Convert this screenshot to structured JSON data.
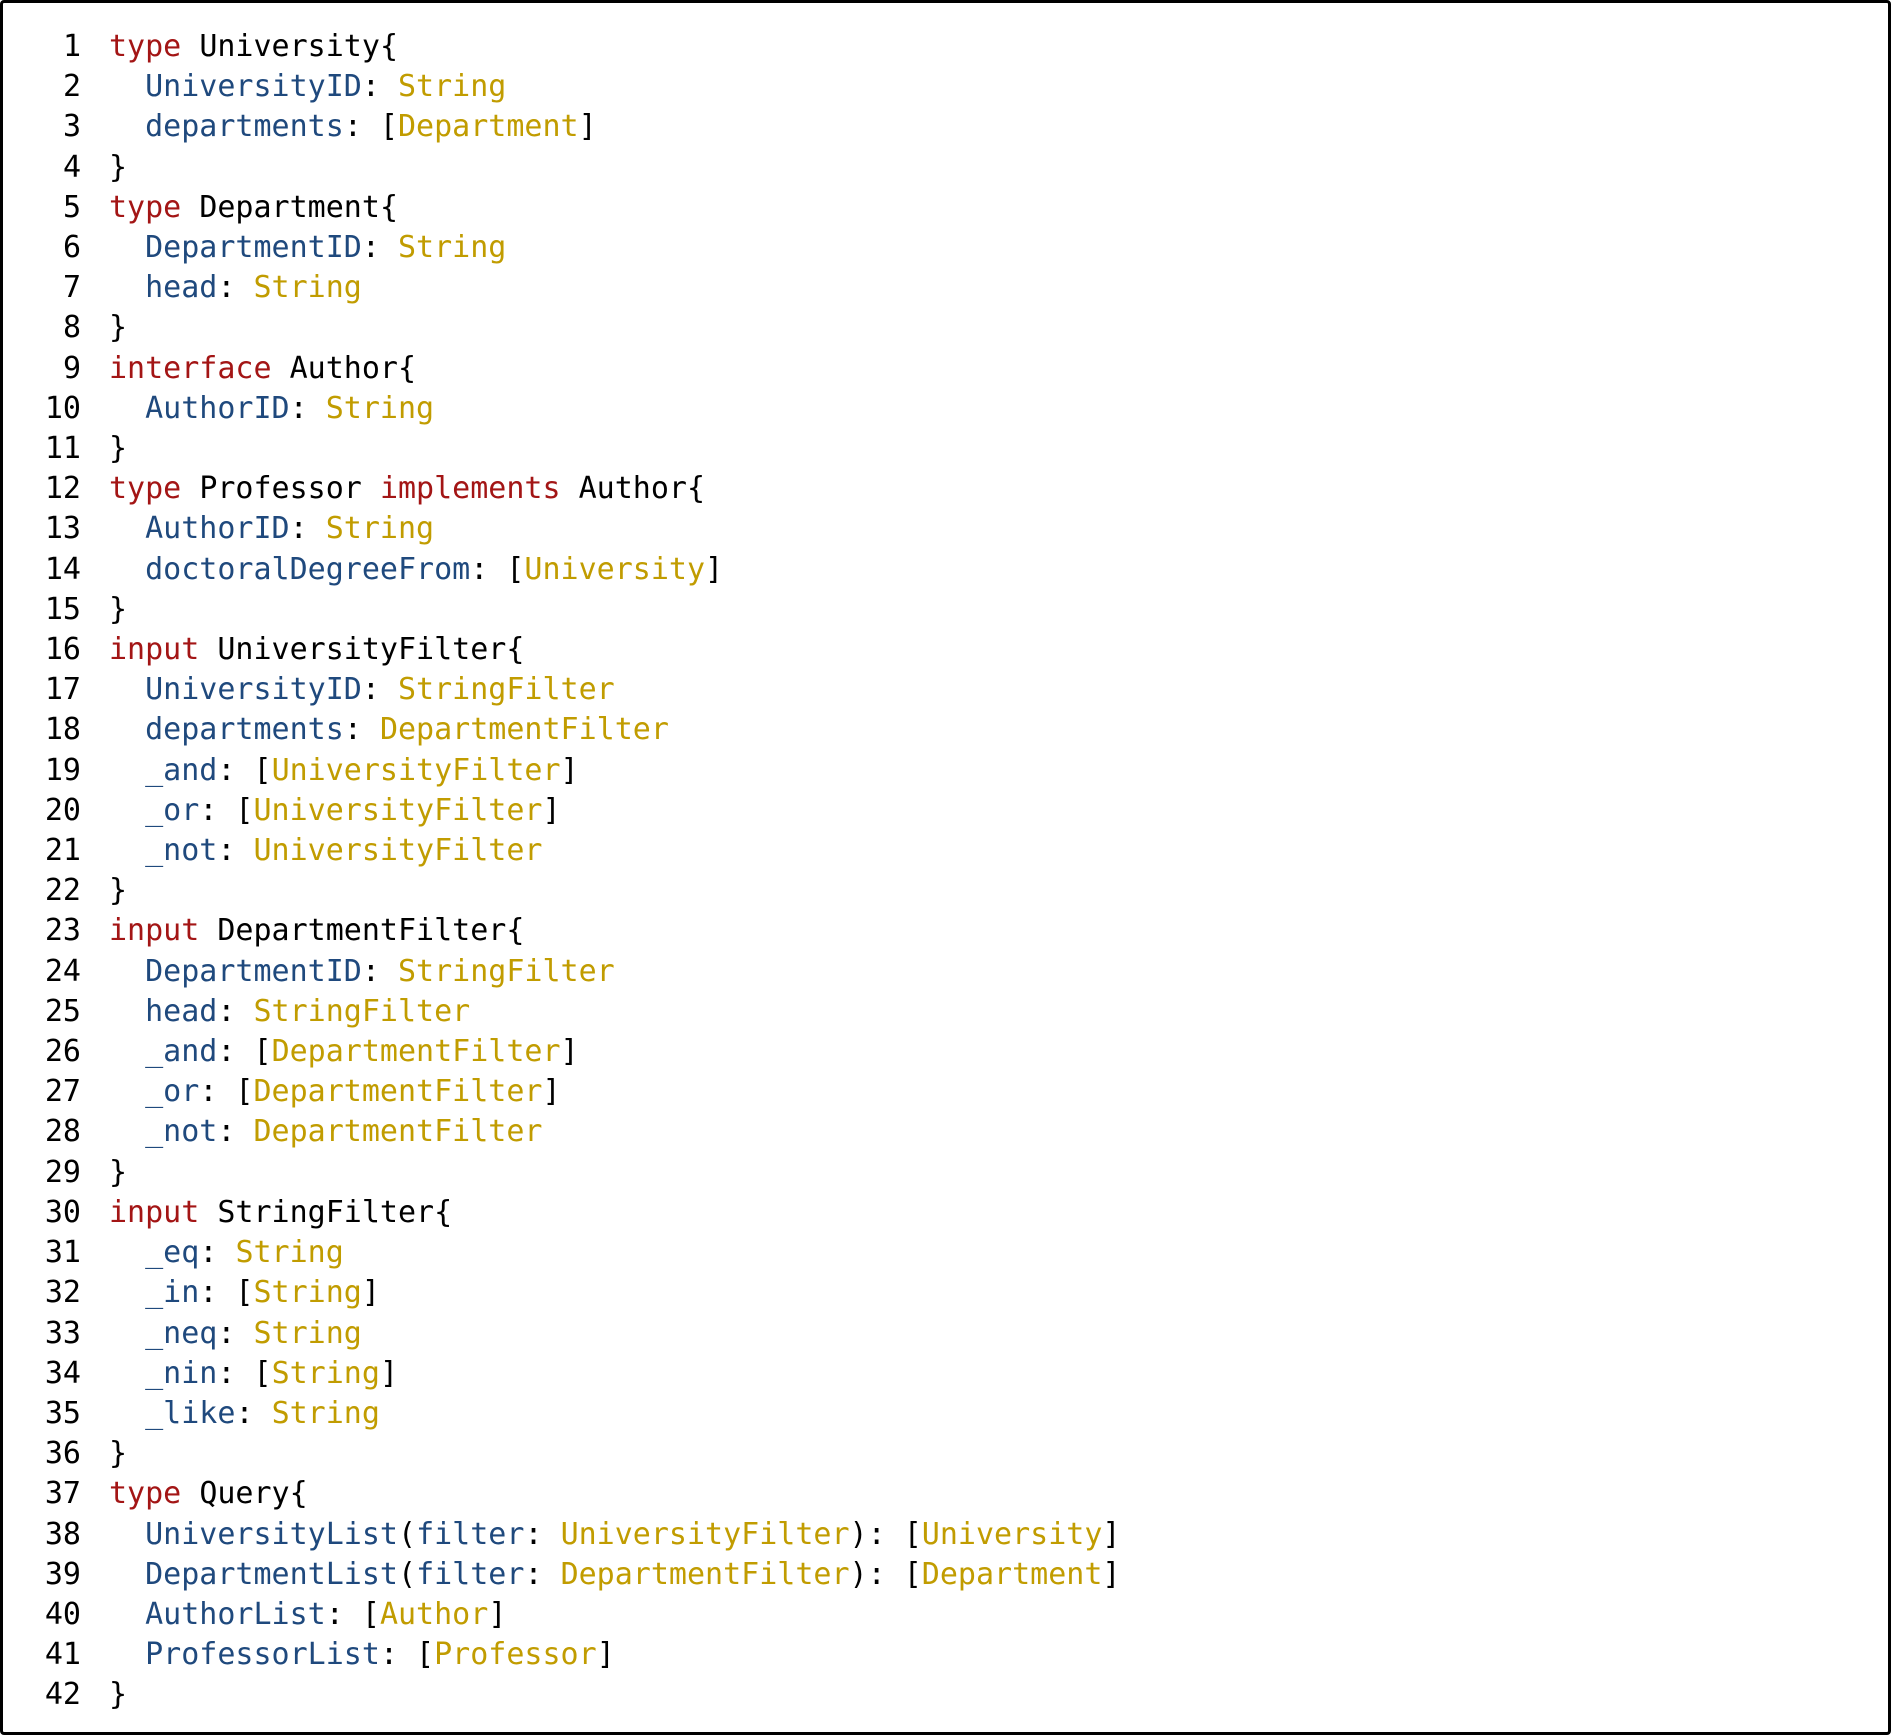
{
  "colors": {
    "keyword": "#a31515",
    "field": "#1f497d",
    "type_ref": "#c19c00",
    "default": "#000000",
    "border": "#000000",
    "background": "#ffffff"
  },
  "code": {
    "language": "GraphQL SDL",
    "lines": [
      {
        "n": 1,
        "tokens": [
          {
            "t": "type ",
            "c": "kw"
          },
          {
            "t": "University",
            "c": "name"
          },
          {
            "t": "{",
            "c": "pun"
          }
        ]
      },
      {
        "n": 2,
        "tokens": [
          {
            "t": "  ",
            "c": "pun"
          },
          {
            "t": "UniversityID",
            "c": "fld"
          },
          {
            "t": ": ",
            "c": "pun"
          },
          {
            "t": "String",
            "c": "typ"
          }
        ]
      },
      {
        "n": 3,
        "tokens": [
          {
            "t": "  ",
            "c": "pun"
          },
          {
            "t": "departments",
            "c": "fld"
          },
          {
            "t": ": [",
            "c": "pun"
          },
          {
            "t": "Department",
            "c": "typ"
          },
          {
            "t": "]",
            "c": "pun"
          }
        ]
      },
      {
        "n": 4,
        "tokens": [
          {
            "t": "}",
            "c": "pun"
          }
        ]
      },
      {
        "n": 5,
        "tokens": [
          {
            "t": "type ",
            "c": "kw"
          },
          {
            "t": "Department",
            "c": "name"
          },
          {
            "t": "{",
            "c": "pun"
          }
        ]
      },
      {
        "n": 6,
        "tokens": [
          {
            "t": "  ",
            "c": "pun"
          },
          {
            "t": "DepartmentID",
            "c": "fld"
          },
          {
            "t": ": ",
            "c": "pun"
          },
          {
            "t": "String",
            "c": "typ"
          }
        ]
      },
      {
        "n": 7,
        "tokens": [
          {
            "t": "  ",
            "c": "pun"
          },
          {
            "t": "head",
            "c": "fld"
          },
          {
            "t": ": ",
            "c": "pun"
          },
          {
            "t": "String",
            "c": "typ"
          }
        ]
      },
      {
        "n": 8,
        "tokens": [
          {
            "t": "}",
            "c": "pun"
          }
        ]
      },
      {
        "n": 9,
        "tokens": [
          {
            "t": "interface ",
            "c": "kw"
          },
          {
            "t": "Author",
            "c": "name"
          },
          {
            "t": "{",
            "c": "pun"
          }
        ]
      },
      {
        "n": 10,
        "tokens": [
          {
            "t": "  ",
            "c": "pun"
          },
          {
            "t": "AuthorID",
            "c": "fld"
          },
          {
            "t": ": ",
            "c": "pun"
          },
          {
            "t": "String",
            "c": "typ"
          }
        ]
      },
      {
        "n": 11,
        "tokens": [
          {
            "t": "}",
            "c": "pun"
          }
        ]
      },
      {
        "n": 12,
        "tokens": [
          {
            "t": "type ",
            "c": "kw"
          },
          {
            "t": "Professor ",
            "c": "name"
          },
          {
            "t": "implements ",
            "c": "kw"
          },
          {
            "t": "Author",
            "c": "name"
          },
          {
            "t": "{",
            "c": "pun"
          }
        ]
      },
      {
        "n": 13,
        "tokens": [
          {
            "t": "  ",
            "c": "pun"
          },
          {
            "t": "AuthorID",
            "c": "fld"
          },
          {
            "t": ": ",
            "c": "pun"
          },
          {
            "t": "String",
            "c": "typ"
          }
        ]
      },
      {
        "n": 14,
        "tokens": [
          {
            "t": "  ",
            "c": "pun"
          },
          {
            "t": "doctoralDegreeFrom",
            "c": "fld"
          },
          {
            "t": ": [",
            "c": "pun"
          },
          {
            "t": "University",
            "c": "typ"
          },
          {
            "t": "]",
            "c": "pun"
          }
        ]
      },
      {
        "n": 15,
        "tokens": [
          {
            "t": "}",
            "c": "pun"
          }
        ]
      },
      {
        "n": 16,
        "tokens": [
          {
            "t": "input ",
            "c": "kw"
          },
          {
            "t": "UniversityFilter",
            "c": "name"
          },
          {
            "t": "{",
            "c": "pun"
          }
        ]
      },
      {
        "n": 17,
        "tokens": [
          {
            "t": "  ",
            "c": "pun"
          },
          {
            "t": "UniversityID",
            "c": "fld"
          },
          {
            "t": ": ",
            "c": "pun"
          },
          {
            "t": "StringFilter",
            "c": "typ"
          }
        ]
      },
      {
        "n": 18,
        "tokens": [
          {
            "t": "  ",
            "c": "pun"
          },
          {
            "t": "departments",
            "c": "fld"
          },
          {
            "t": ": ",
            "c": "pun"
          },
          {
            "t": "DepartmentFilter",
            "c": "typ"
          }
        ]
      },
      {
        "n": 19,
        "tokens": [
          {
            "t": "  ",
            "c": "pun"
          },
          {
            "t": "_and",
            "c": "fld"
          },
          {
            "t": ": [",
            "c": "pun"
          },
          {
            "t": "UniversityFilter",
            "c": "typ"
          },
          {
            "t": "]",
            "c": "pun"
          }
        ]
      },
      {
        "n": 20,
        "tokens": [
          {
            "t": "  ",
            "c": "pun"
          },
          {
            "t": "_or",
            "c": "fld"
          },
          {
            "t": ": [",
            "c": "pun"
          },
          {
            "t": "UniversityFilter",
            "c": "typ"
          },
          {
            "t": "]",
            "c": "pun"
          }
        ]
      },
      {
        "n": 21,
        "tokens": [
          {
            "t": "  ",
            "c": "pun"
          },
          {
            "t": "_not",
            "c": "fld"
          },
          {
            "t": ": ",
            "c": "pun"
          },
          {
            "t": "UniversityFilter",
            "c": "typ"
          }
        ]
      },
      {
        "n": 22,
        "tokens": [
          {
            "t": "}",
            "c": "pun"
          }
        ]
      },
      {
        "n": 23,
        "tokens": [
          {
            "t": "input ",
            "c": "kw"
          },
          {
            "t": "DepartmentFilter",
            "c": "name"
          },
          {
            "t": "{",
            "c": "pun"
          }
        ]
      },
      {
        "n": 24,
        "tokens": [
          {
            "t": "  ",
            "c": "pun"
          },
          {
            "t": "DepartmentID",
            "c": "fld"
          },
          {
            "t": ": ",
            "c": "pun"
          },
          {
            "t": "StringFilter",
            "c": "typ"
          }
        ]
      },
      {
        "n": 25,
        "tokens": [
          {
            "t": "  ",
            "c": "pun"
          },
          {
            "t": "head",
            "c": "fld"
          },
          {
            "t": ": ",
            "c": "pun"
          },
          {
            "t": "StringFilter",
            "c": "typ"
          }
        ]
      },
      {
        "n": 26,
        "tokens": [
          {
            "t": "  ",
            "c": "pun"
          },
          {
            "t": "_and",
            "c": "fld"
          },
          {
            "t": ": [",
            "c": "pun"
          },
          {
            "t": "DepartmentFilter",
            "c": "typ"
          },
          {
            "t": "]",
            "c": "pun"
          }
        ]
      },
      {
        "n": 27,
        "tokens": [
          {
            "t": "  ",
            "c": "pun"
          },
          {
            "t": "_or",
            "c": "fld"
          },
          {
            "t": ": [",
            "c": "pun"
          },
          {
            "t": "DepartmentFilter",
            "c": "typ"
          },
          {
            "t": "]",
            "c": "pun"
          }
        ]
      },
      {
        "n": 28,
        "tokens": [
          {
            "t": "  ",
            "c": "pun"
          },
          {
            "t": "_not",
            "c": "fld"
          },
          {
            "t": ": ",
            "c": "pun"
          },
          {
            "t": "DepartmentFilter",
            "c": "typ"
          }
        ]
      },
      {
        "n": 29,
        "tokens": [
          {
            "t": "}",
            "c": "pun"
          }
        ]
      },
      {
        "n": 30,
        "tokens": [
          {
            "t": "input ",
            "c": "kw"
          },
          {
            "t": "StringFilter",
            "c": "name"
          },
          {
            "t": "{",
            "c": "pun"
          }
        ]
      },
      {
        "n": 31,
        "tokens": [
          {
            "t": "  ",
            "c": "pun"
          },
          {
            "t": "_eq",
            "c": "fld"
          },
          {
            "t": ": ",
            "c": "pun"
          },
          {
            "t": "String",
            "c": "typ"
          }
        ]
      },
      {
        "n": 32,
        "tokens": [
          {
            "t": "  ",
            "c": "pun"
          },
          {
            "t": "_in",
            "c": "fld"
          },
          {
            "t": ": [",
            "c": "pun"
          },
          {
            "t": "String",
            "c": "typ"
          },
          {
            "t": "]",
            "c": "pun"
          }
        ]
      },
      {
        "n": 33,
        "tokens": [
          {
            "t": "  ",
            "c": "pun"
          },
          {
            "t": "_neq",
            "c": "fld"
          },
          {
            "t": ": ",
            "c": "pun"
          },
          {
            "t": "String",
            "c": "typ"
          }
        ]
      },
      {
        "n": 34,
        "tokens": [
          {
            "t": "  ",
            "c": "pun"
          },
          {
            "t": "_nin",
            "c": "fld"
          },
          {
            "t": ": [",
            "c": "pun"
          },
          {
            "t": "String",
            "c": "typ"
          },
          {
            "t": "]",
            "c": "pun"
          }
        ]
      },
      {
        "n": 35,
        "tokens": [
          {
            "t": "  ",
            "c": "pun"
          },
          {
            "t": "_like",
            "c": "fld"
          },
          {
            "t": ": ",
            "c": "pun"
          },
          {
            "t": "String",
            "c": "typ"
          }
        ]
      },
      {
        "n": 36,
        "tokens": [
          {
            "t": "}",
            "c": "pun"
          }
        ]
      },
      {
        "n": 37,
        "tokens": [
          {
            "t": "type ",
            "c": "kw"
          },
          {
            "t": "Query",
            "c": "name"
          },
          {
            "t": "{",
            "c": "pun"
          }
        ]
      },
      {
        "n": 38,
        "tokens": [
          {
            "t": "  ",
            "c": "pun"
          },
          {
            "t": "UniversityList",
            "c": "fld"
          },
          {
            "t": "(",
            "c": "pun"
          },
          {
            "t": "filter",
            "c": "fld"
          },
          {
            "t": ": ",
            "c": "pun"
          },
          {
            "t": "UniversityFilter",
            "c": "typ"
          },
          {
            "t": "): [",
            "c": "pun"
          },
          {
            "t": "University",
            "c": "typ"
          },
          {
            "t": "]",
            "c": "pun"
          }
        ]
      },
      {
        "n": 39,
        "tokens": [
          {
            "t": "  ",
            "c": "pun"
          },
          {
            "t": "DepartmentList",
            "c": "fld"
          },
          {
            "t": "(",
            "c": "pun"
          },
          {
            "t": "filter",
            "c": "fld"
          },
          {
            "t": ": ",
            "c": "pun"
          },
          {
            "t": "DepartmentFilter",
            "c": "typ"
          },
          {
            "t": "): [",
            "c": "pun"
          },
          {
            "t": "Department",
            "c": "typ"
          },
          {
            "t": "]",
            "c": "pun"
          }
        ]
      },
      {
        "n": 40,
        "tokens": [
          {
            "t": "  ",
            "c": "pun"
          },
          {
            "t": "AuthorList",
            "c": "fld"
          },
          {
            "t": ": [",
            "c": "pun"
          },
          {
            "t": "Author",
            "c": "typ"
          },
          {
            "t": "]",
            "c": "pun"
          }
        ]
      },
      {
        "n": 41,
        "tokens": [
          {
            "t": "  ",
            "c": "pun"
          },
          {
            "t": "ProfessorList",
            "c": "fld"
          },
          {
            "t": ": [",
            "c": "pun"
          },
          {
            "t": "Professor",
            "c": "typ"
          },
          {
            "t": "]",
            "c": "pun"
          }
        ]
      },
      {
        "n": 42,
        "tokens": [
          {
            "t": "}",
            "c": "pun"
          }
        ]
      }
    ]
  }
}
